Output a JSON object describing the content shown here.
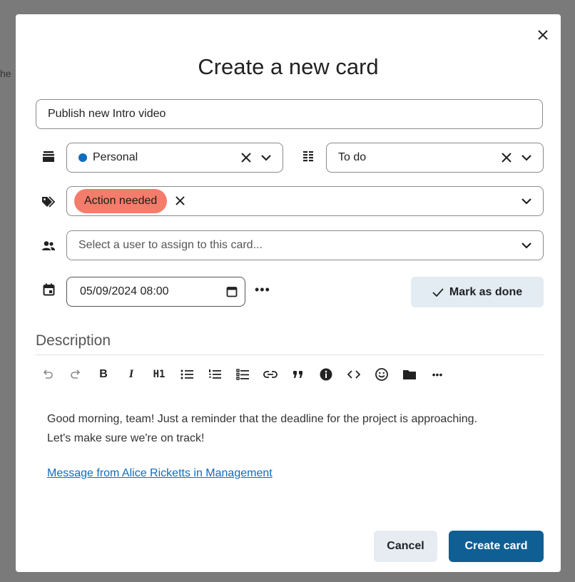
{
  "background": {
    "fragment_text": "he"
  },
  "modal": {
    "title": "Create a new card",
    "close_glyph": "✕",
    "card_title_value": "Publish new Intro video"
  },
  "board": {
    "icon": "stack-icon",
    "value": "Personal",
    "color": "#0f6cbf"
  },
  "column": {
    "icon": "columns-icon",
    "value": "To do"
  },
  "labels": {
    "icon": "tags-icon",
    "tags": [
      {
        "text": "Action needed",
        "color": "#f47c6a"
      }
    ]
  },
  "assignee": {
    "icon": "users-icon",
    "placeholder": "Select a user to assign to this card..."
  },
  "due_date": {
    "icon": "calendar-icon",
    "value": "05/09/2024 08:00",
    "more": "•••"
  },
  "mark_done": {
    "label": "Mark as done"
  },
  "description": {
    "label": "Description",
    "toolbar": [
      "undo",
      "redo",
      "bold",
      "italic",
      "heading-1",
      "bullet-list",
      "numbered-list",
      "checklist",
      "link",
      "quote",
      "info",
      "code",
      "emoji",
      "folder",
      "more"
    ],
    "toolbar_text": {
      "bold": "B",
      "italic": "I",
      "heading": "H1",
      "more": "•••"
    },
    "paragraph": "Good morning, team! Just a reminder that the deadline for the project is approaching. Let's make sure we're on track!",
    "link_text": "Message from Alice Ricketts in Management"
  },
  "actions": {
    "cancel": "Cancel",
    "create": "Create card"
  }
}
